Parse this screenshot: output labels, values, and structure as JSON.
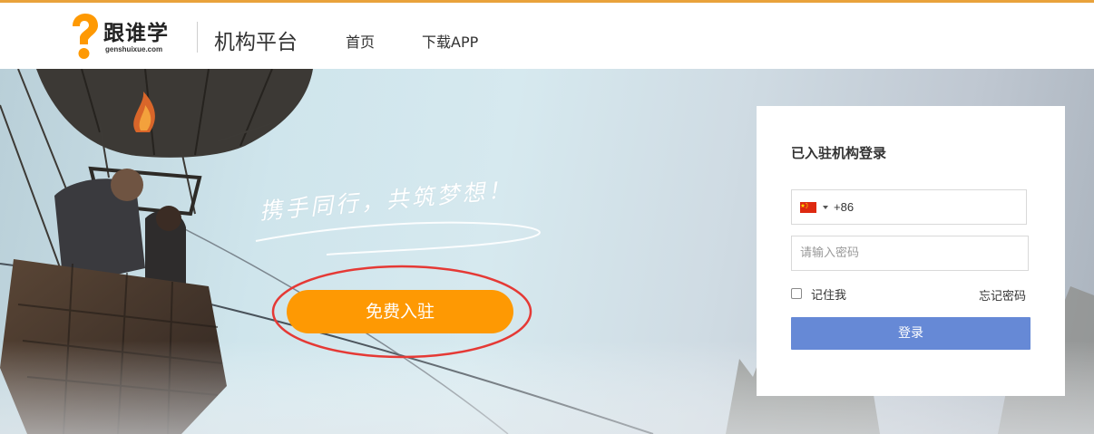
{
  "header": {
    "logo_text": "跟谁学",
    "logo_domain": "genshuixue.com",
    "platform_title": "机构平台",
    "nav": [
      {
        "label": "首页"
      },
      {
        "label": "下载APP"
      }
    ],
    "accent_color": "#e9a23b"
  },
  "hero": {
    "slogan": "携手同行，共筑梦想！",
    "join_button_label": "免费入驻",
    "join_button_color": "#fe9903",
    "highlight_color": "#e53935"
  },
  "login": {
    "title": "已入驻机构登录",
    "country_flag": "china-flag-icon",
    "country_code": "+86",
    "password_placeholder": "请输入密码",
    "remember_label": "记住我",
    "forgot_label": "忘记密码",
    "submit_label": "登录",
    "submit_color": "#6689d6"
  }
}
